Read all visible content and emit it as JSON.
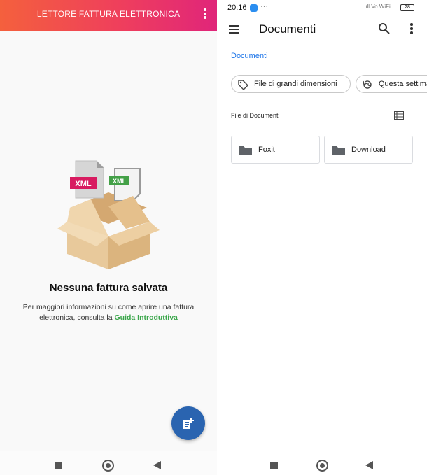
{
  "left": {
    "app_title": "LETTORE FATTURA ELETTRONICA",
    "illustration": {
      "file_label_1": "XML",
      "file_label_2": "XML",
      "colors": {
        "xml_pink": "#d81b60",
        "xml_green": "#43a047",
        "box": "#e7c79b"
      }
    },
    "empty_title": "Nessuna fattura salvata",
    "empty_desc_prefix": "Per maggiori informazioni su come aprire una fattura elettronica, consulta la ",
    "empty_desc_link": "Guida Introduttiva",
    "fab_icon": "document-add-icon",
    "colors": {
      "gradient_start": "#f4603d",
      "gradient_end": "#e0257a",
      "fab": "#2a64b0",
      "link": "#3aa64a"
    }
  },
  "right": {
    "status": {
      "time": "20:16",
      "dots": "···",
      "signal_text": ".ıll Vo WiFi",
      "battery": "28"
    },
    "title": "Documenti",
    "breadcrumb": "Documenti",
    "chips": [
      {
        "label": "File di grandi dimensioni",
        "icon": "tag-icon"
      },
      {
        "label": "Questa settimana",
        "icon": "history-icon"
      }
    ],
    "section_title": "File di Documenti",
    "folders": [
      {
        "name": "Foxit",
        "icon": "folder-icon"
      },
      {
        "name": "Download",
        "icon": "folder-icon"
      }
    ],
    "colors": {
      "accent": "#1a73e8"
    }
  }
}
